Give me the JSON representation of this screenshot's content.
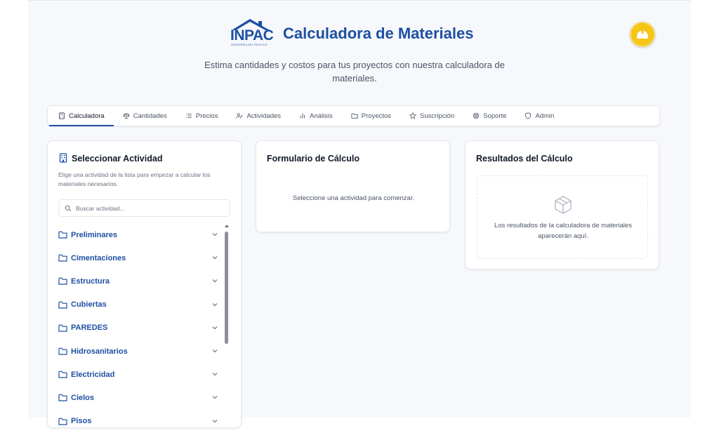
{
  "header": {
    "logo_text": "INPAC",
    "logo_subtext": "INGENIERIA DEL PACIFICO",
    "title": "Calculadora de Materiales",
    "subtitle": "Estima cantidades y costos para tus proyectos con nuestra calculadora de materiales."
  },
  "tabs": [
    {
      "label": "Calculadora",
      "icon": "calculator-icon",
      "active": true
    },
    {
      "label": "Cantidades",
      "icon": "scale-icon"
    },
    {
      "label": "Precios",
      "icon": "list-icon"
    },
    {
      "label": "Actividades",
      "icon": "users-icon"
    },
    {
      "label": "Análisis",
      "icon": "bar-chart-icon"
    },
    {
      "label": "Proyectos",
      "icon": "folder-icon"
    },
    {
      "label": "Suscripción",
      "icon": "star-icon"
    },
    {
      "label": "Soporte",
      "icon": "life-buoy-icon"
    },
    {
      "label": "Admin",
      "icon": "shield-icon"
    }
  ],
  "activity_panel": {
    "title": "Seleccionar Actividad",
    "description": "Elige una actividad de la lista para empezar a calcular los materiales necesarios.",
    "search_placeholder": "Buscar actividad...",
    "categories": [
      "Preliminares",
      "Cimentaciones",
      "Estructura",
      "Cubiertas",
      "PAREDES",
      "Hidrosanitarios",
      "Electricidad",
      "Cielos",
      "Pisos"
    ]
  },
  "form_panel": {
    "title": "Formulario de Cálculo",
    "message": "Seleccione una actividad para comenzar."
  },
  "results_panel": {
    "title": "Resultados del Cálculo",
    "message": "Los resultados de la calculadora de materiales aparecerán aquí."
  },
  "colors": {
    "brand": "#1e4fa3",
    "accent": "#f5c518",
    "background": "#f6f8fc"
  }
}
